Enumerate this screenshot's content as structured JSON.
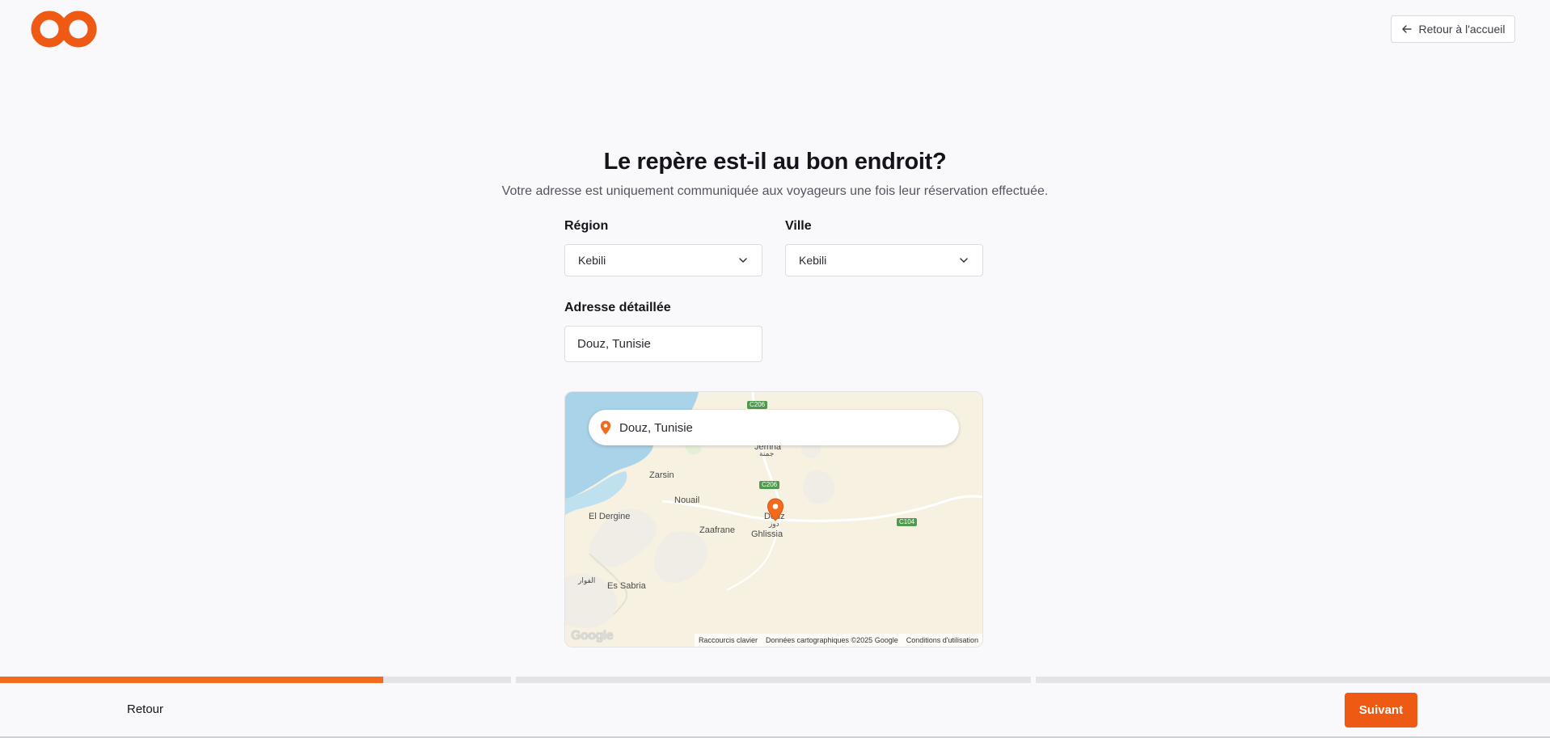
{
  "brand": {
    "accent": "#ee5a14",
    "logo_icon": "infinity-logo"
  },
  "header": {
    "home_button_label": "Retour à l'accueil",
    "home_button_icon": "arrow-left-icon"
  },
  "main": {
    "title": "Le repère est-il au bon endroit?",
    "subtitle": "Votre adresse est uniquement communiquée aux voyageurs une fois leur réservation effectuée."
  },
  "form": {
    "region": {
      "label": "Région",
      "value": "Kebili"
    },
    "city": {
      "label": "Ville",
      "value": "Kebili"
    },
    "address": {
      "label": "Adresse détaillée",
      "value": "Douz, Tunisie"
    }
  },
  "map": {
    "search_value": "Douz, Tunisie",
    "places": {
      "zarsin": "Zarsin",
      "nouail": "Nouail",
      "el_dergine": "El Dergine",
      "zaafrane": "Zaafrane",
      "ghlissia": "Ghlissia",
      "es_sabria": "Es Sabria",
      "douz": "Douz",
      "douz_ar": "دوز",
      "el_faouar_ar": "الفوار",
      "jemna": "Jemna",
      "jemna_ar": "جمنة"
    },
    "roads": {
      "c206_top": "C206",
      "c206": "C206",
      "c104": "C104"
    },
    "google": "Google",
    "footer": {
      "shortcuts": "Raccourcis clavier",
      "data": "Données cartographiques ©2025 Google",
      "terms": "Conditions d'utilisation"
    }
  },
  "progress": {
    "step1_fraction": 0.75,
    "step2_fraction": 0,
    "step3_fraction": 0
  },
  "footer": {
    "back_label": "Retour",
    "next_label": "Suivant"
  }
}
